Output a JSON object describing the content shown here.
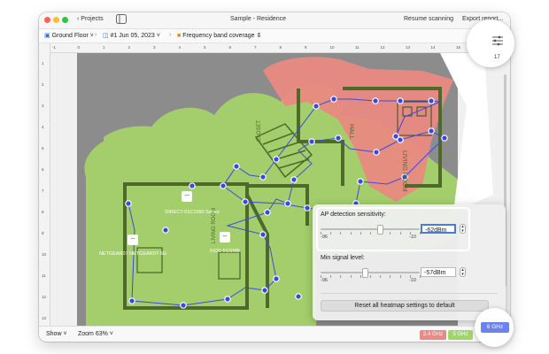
{
  "titlebar": {
    "back_label": "Projects",
    "title": "Sample - Residence",
    "resume_label": "Resume scanning",
    "export_label": "Export report..."
  },
  "pathbar": {
    "floor": "Ground Floor",
    "scan": "#1 Jun 05, 2023",
    "view": "Frequency band coverage"
  },
  "ruler": {
    "h_ticks": [
      "-1",
      "0",
      "1",
      "2",
      "3",
      "4",
      "5",
      "6",
      "7",
      "8",
      "9",
      "10",
      "11",
      "12",
      "13",
      "14",
      "15",
      "17"
    ],
    "v_ticks": [
      "1",
      "2",
      "3",
      "4",
      "5",
      "6",
      "7",
      "8",
      "9",
      "10",
      "11",
      "12",
      "13"
    ]
  },
  "map": {
    "access_points": [
      {
        "label": "DIRECT-01C1060 Series"
      },
      {
        "label": "NETGEAR07 NETGEAR07-5G"
      },
      {
        "label": "FiOS-5GSMB"
      }
    ],
    "room_labels": [
      "HALL",
      "LIVING ROOM",
      "CLOSET",
      "LIVING ROOM"
    ],
    "colors": {
      "green": "#a5d26a",
      "red": "#e98a82",
      "walls": "#4d6a2a",
      "points": "#3b49e0"
    }
  },
  "popover": {
    "sensitivity_label": "AP detection sensitivity:",
    "sensitivity_value": "-62dBm",
    "sensitivity_level": 0.6,
    "sensitivity_min": "-96",
    "sensitivity_max": "-10",
    "signal_label": "Min signal level:",
    "signal_value": "-57dBm",
    "signal_level": 0.45,
    "signal_min": "-96",
    "signal_max": "-10",
    "reset_label": "Reset all heatmap settings to default"
  },
  "bottombar": {
    "show_label": "Show",
    "zoom_label": "Zoom 63%",
    "bands": [
      {
        "label": "2.4 GHz",
        "color": "#e88a85"
      },
      {
        "label": "5 GHz",
        "color": "#9fd56a"
      },
      {
        "label": "6 GHz",
        "color": "#6b82f0"
      }
    ]
  }
}
